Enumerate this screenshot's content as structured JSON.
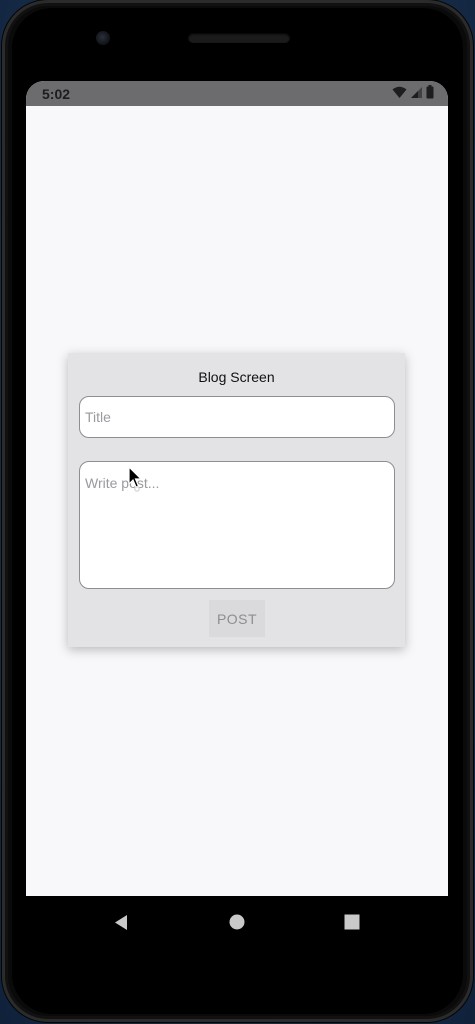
{
  "status_bar": {
    "time": "5:02",
    "icons": [
      "wifi-icon",
      "cell-signal-icon",
      "battery-icon"
    ]
  },
  "card": {
    "title": "Blog Screen",
    "title_placeholder": "Title",
    "body_placeholder": "Write post...",
    "post_label": "POST"
  },
  "nav_bar": {
    "buttons": [
      "back-icon",
      "home-icon",
      "recents-icon"
    ]
  },
  "colors": {
    "screen_bg": "#f8f7fa",
    "card_bg": "#e3e2e5",
    "status_bar_bg": "#6c6c6f",
    "input_border": "#8d8d92",
    "placeholder": "#9a9a9f",
    "post_button_bg": "#dadadd",
    "post_button_text": "#8d8d92"
  }
}
